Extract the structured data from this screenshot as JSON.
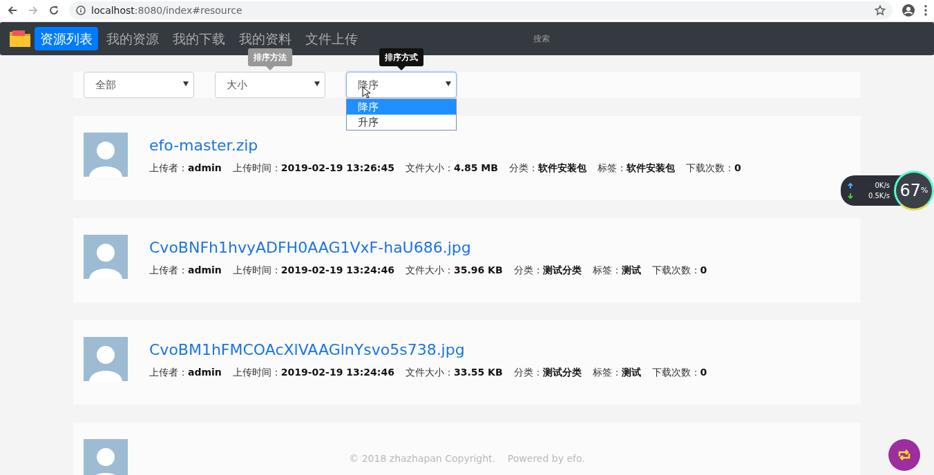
{
  "browser": {
    "url_host": "localhost",
    "url_rest": ":8080/index#resource"
  },
  "navbar": {
    "items": [
      {
        "label": "资源列表",
        "selected": true
      },
      {
        "label": "我的资源",
        "selected": false
      },
      {
        "label": "我的下载",
        "selected": false
      },
      {
        "label": "我的资料",
        "selected": false
      },
      {
        "label": "文件上传",
        "selected": false
      }
    ],
    "search_placeholder": "搜索"
  },
  "filters": [
    {
      "value": "全部"
    },
    {
      "value": "大小",
      "tooltip": {
        "text": "排序方法",
        "fading": true
      }
    },
    {
      "value": "降序",
      "tooltip": {
        "text": "排序方式",
        "fading": false
      },
      "expanded": true,
      "options": [
        {
          "label": "降序",
          "selected": true
        },
        {
          "label": "升序",
          "selected": false
        }
      ]
    }
  ],
  "resources": [
    {
      "name": "efo-master.zip",
      "meta": [
        {
          "label": "上传者：",
          "value": "admin"
        },
        {
          "label": "上传时间：",
          "value": "2019-02-19 13:26:45"
        },
        {
          "label": "文件大小：",
          "value": "4.85 MB"
        },
        {
          "label": "分类：",
          "value": "软件安装包"
        },
        {
          "label": "标签：",
          "value": "软件安装包"
        },
        {
          "label": "下载次数：",
          "value": "0"
        }
      ]
    },
    {
      "name": "CvoBNFh1hvyADFH0AAG1VxF-haU686.jpg",
      "meta": [
        {
          "label": "上传者：",
          "value": "admin"
        },
        {
          "label": "上传时间：",
          "value": "2019-02-19 13:24:46"
        },
        {
          "label": "文件大小：",
          "value": "35.96 KB"
        },
        {
          "label": "分类：",
          "value": "测试分类"
        },
        {
          "label": "标签：",
          "value": "测试"
        },
        {
          "label": "下载次数：",
          "value": "0"
        }
      ]
    },
    {
      "name": "CvoBM1hFMCOAcXlVAAGlnYsvo5s738.jpg",
      "meta": [
        {
          "label": "上传者：",
          "value": "admin"
        },
        {
          "label": "上传时间：",
          "value": "2019-02-19 13:24:46"
        },
        {
          "label": "文件大小：",
          "value": "33.55 KB"
        },
        {
          "label": "分类：",
          "value": "测试分类"
        },
        {
          "label": "标签：",
          "value": "测试"
        },
        {
          "label": "下载次数：",
          "value": "0"
        }
      ]
    },
    {
      "cut_off": true
    }
  ],
  "footer": "© 2018 zhazhapan Copyright.    Powered by efo.",
  "net_monitor": {
    "upload": "0",
    "upload_unit": "K/s",
    "download": "0.5",
    "download_unit": "K/s",
    "percent": "67",
    "percent_sign": "%"
  }
}
